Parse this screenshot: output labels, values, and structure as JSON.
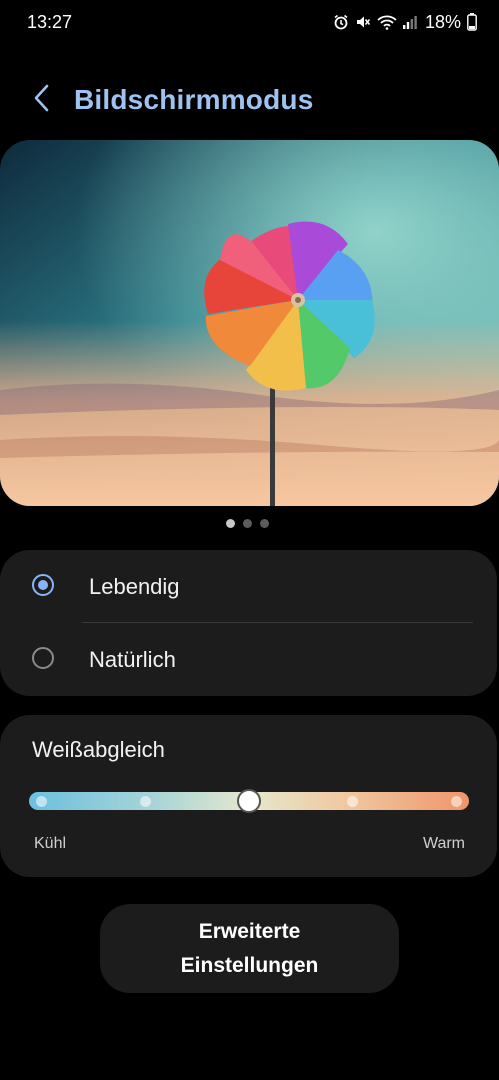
{
  "status_bar": {
    "time": "13:27",
    "battery": "18%",
    "icons": [
      "alarm-icon",
      "mute-icon",
      "wifi-icon",
      "signal-icon",
      "battery-icon"
    ]
  },
  "header": {
    "back_icon": "chevron-left-icon",
    "title": "Bildschirmmodus"
  },
  "preview": {
    "pages": 3,
    "active_page": 1
  },
  "modes": {
    "options": [
      {
        "label": "Lebendig",
        "selected": true
      },
      {
        "label": "Natürlich",
        "selected": false
      }
    ]
  },
  "white_balance": {
    "title": "Weißabgleich",
    "min_label": "Kühl",
    "max_label": "Warm",
    "steps": 5,
    "value_fraction": 0.5
  },
  "advanced": {
    "line1": "Erweiterte",
    "line2": "Einstellungen"
  },
  "colors": {
    "title": "#9ec3f0",
    "accent": "#8ab4f8",
    "card": "#1c1c1c"
  }
}
